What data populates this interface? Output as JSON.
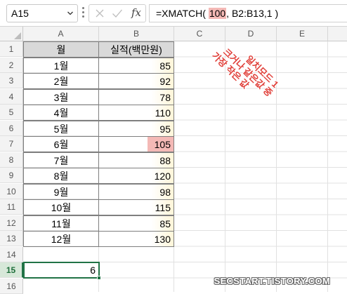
{
  "formula_bar": {
    "name_box": "A15",
    "fx_label": "fx",
    "formula_prefix": "=XMATCH( ",
    "formula_highlight": "100",
    "formula_suffix": ", B2:B13,1 )"
  },
  "columns": [
    "A",
    "B",
    "C",
    "D",
    "E"
  ],
  "rows": [
    "1",
    "2",
    "3",
    "4",
    "5",
    "6",
    "7",
    "8",
    "9",
    "10",
    "11",
    "12",
    "13",
    "14",
    "15",
    "16"
  ],
  "table": {
    "header": [
      "월",
      "실적(백만원)"
    ],
    "months": [
      "1월",
      "2월",
      "3월",
      "4월",
      "5월",
      "6월",
      "7월",
      "8월",
      "9월",
      "10월",
      "11월",
      "12월"
    ],
    "values": [
      "85",
      "92",
      "78",
      "110",
      "95",
      "105",
      "88",
      "120",
      "98",
      "115",
      "85",
      "130"
    ]
  },
  "result": "6",
  "annotation": {
    "line1": "일치모드 1",
    "line2": "크거나 같은값 중",
    "line3": "가장 작은 값"
  },
  "watermark": "SECSTART.TISTORY.COM",
  "colors": {
    "accent": "#217346",
    "highlight": "#f4b9b6",
    "header_fill": "#d9d9d9"
  }
}
